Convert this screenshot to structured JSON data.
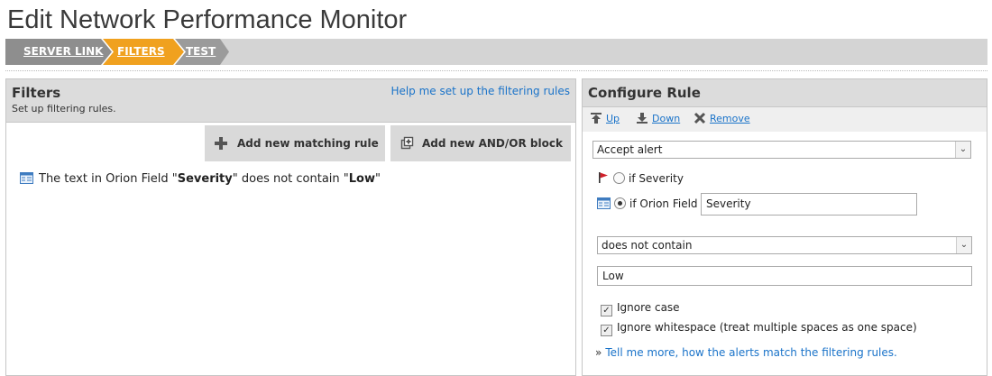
{
  "page": {
    "title": "Edit Network Performance Monitor"
  },
  "wizard": {
    "steps": [
      {
        "label": "SERVER LINK"
      },
      {
        "label": "FILTERS"
      },
      {
        "label": "TEST"
      }
    ]
  },
  "filters_panel": {
    "title": "Filters",
    "subtitle": "Set up filtering rules.",
    "help_link": "Help me set up the filtering rules",
    "add_rule_button": "Add new matching rule",
    "add_block_button": "Add new AND/OR block",
    "rule": {
      "prefix": "The text in Orion Field \"",
      "field": "Severity",
      "middle": "\" does not contain \"",
      "value": "Low",
      "suffix": "\""
    }
  },
  "configure_panel": {
    "title": "Configure Rule",
    "toolbar": {
      "up": "Up",
      "down": "Down",
      "remove": "Remove"
    },
    "action_select": "Accept alert",
    "option_severity": "if Severity",
    "option_orion_field": "if Orion Field",
    "orion_field_value": "Severity",
    "operator_select": "does not contain",
    "value_input": "Low",
    "ignore_case": {
      "label": "Ignore case",
      "checked": true
    },
    "ignore_whitespace": {
      "label": "Ignore whitespace (treat multiple spaces as one space)",
      "checked": true
    },
    "more_link": "Tell me more, how the alerts match the filtering rules.",
    "more_bullet": "»"
  }
}
